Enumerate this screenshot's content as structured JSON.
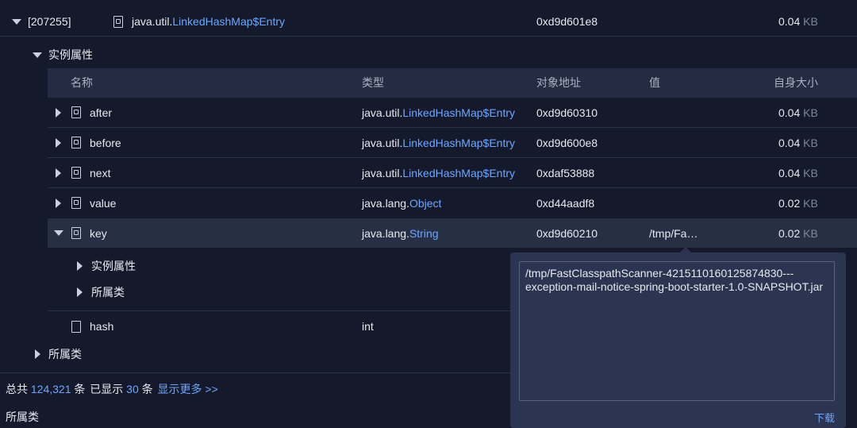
{
  "top_entry": {
    "id": "[207255]",
    "type_prefix": "java.util.",
    "type_class": "LinkedHashMap$Entry",
    "address": "0xd9d601e8",
    "size_value": "0.04",
    "size_unit": "KB"
  },
  "instance_props_label": "实例属性",
  "columns": {
    "name": "名称",
    "type": "类型",
    "address": "对象地址",
    "value": "值",
    "self_size": "自身大小"
  },
  "fields": [
    {
      "name": "after",
      "type_prefix": "java.util.",
      "type_class": "LinkedHashMap$Entry",
      "address": "0xd9d60310",
      "value": "",
      "size_value": "0.04",
      "size_unit": "KB"
    },
    {
      "name": "before",
      "type_prefix": "java.util.",
      "type_class": "LinkedHashMap$Entry",
      "address": "0xd9d600e8",
      "value": "",
      "size_value": "0.04",
      "size_unit": "KB"
    },
    {
      "name": "next",
      "type_prefix": "java.util.",
      "type_class": "LinkedHashMap$Entry",
      "address": "0xdaf53888",
      "value": "",
      "size_value": "0.04",
      "size_unit": "KB"
    },
    {
      "name": "value",
      "type_prefix": "java.lang.",
      "type_class": "Object",
      "address": "0xd44aadf8",
      "value": "",
      "size_value": "0.02",
      "size_unit": "KB"
    },
    {
      "name": "key",
      "type_prefix": "java.lang.",
      "type_class": "String",
      "address": "0xd9d60210",
      "value": "/tmp/Fa…",
      "size_value": "0.02",
      "size_unit": "KB"
    }
  ],
  "key_children": {
    "instance_props": "实例属性",
    "owner_class": "所属类"
  },
  "hash_field": {
    "name": "hash",
    "type": "int"
  },
  "owner_class_label": "所属类",
  "footer": {
    "total_prefix": "总共",
    "total_count": "124,321",
    "total_suffix": "条",
    "shown_prefix": "已显示",
    "shown_count": "30",
    "shown_suffix": "条",
    "show_more": "显示更多 >>"
  },
  "bottom_section_label": "所属类",
  "popup": {
    "text": "/tmp/FastClasspathScanner-4215110160125874830---exception-mail-notice-spring-boot-starter-1.0-SNAPSHOT.jar",
    "download_label": "下载"
  },
  "colors": {
    "background": "#141a2b",
    "header_band": "#242b42",
    "accent": "#6ea6ff",
    "popup": "#2b3450"
  },
  "icons": [
    "chevron-down-icon",
    "chevron-right-icon",
    "class-doc-icon",
    "file-icon"
  ]
}
